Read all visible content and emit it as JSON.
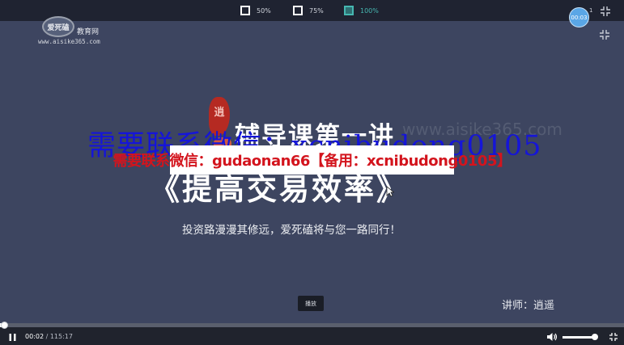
{
  "zoom_options": [
    {
      "label": "50%",
      "active": false
    },
    {
      "label": "75%",
      "active": false
    },
    {
      "label": "100%",
      "active": true
    }
  ],
  "timer_bubble": "00:03",
  "top_digit": "1",
  "logo": {
    "mark": "爱死磕",
    "name": "教育网",
    "url": "www.aisike365.com"
  },
  "slide": {
    "seal_char": "逍",
    "lesson_title": "辅导课第一讲",
    "bg_watermark": "www.aisike365.com",
    "main_title": "《提高交易效率》",
    "subtitle": "投资路漫漫其修远，爱死磕将与您一路同行！",
    "lecturer": "讲师：逍遥"
  },
  "overlay": {
    "blue_text": "需要联系微信：xcnibudong0105",
    "contact_text": "需要联系微信：gudaonan66【备用：xcnibudong0105】"
  },
  "tooltip": "播放",
  "playback": {
    "current_time": "00:02",
    "separator": " / ",
    "duration": "115:17",
    "progress": 0.0003,
    "volume": 0.95
  },
  "colors": {
    "accent": "#46b7b1",
    "overlay_red": "#d3141d",
    "overlay_blue": "#1515d8",
    "timer": "#5aa6e6"
  },
  "icons": [
    "pause-icon",
    "volume-icon",
    "fullscreen-icon",
    "collapse-icon",
    "exit-fullscreen-icon"
  ]
}
